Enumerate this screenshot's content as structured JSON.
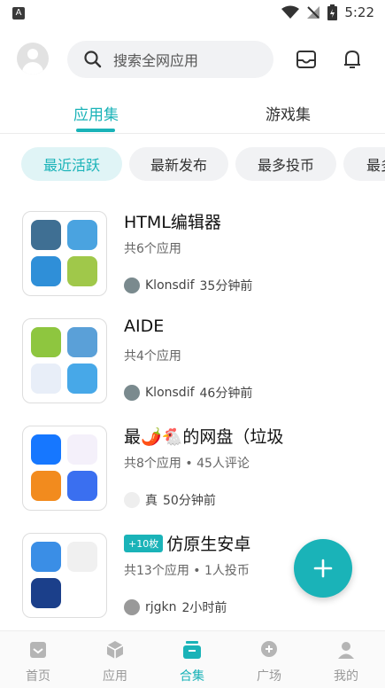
{
  "status": {
    "time": "5:22",
    "left_icon": "A"
  },
  "search": {
    "placeholder": "搜索全网应用"
  },
  "tabs": [
    {
      "label": "应用集",
      "active": true
    },
    {
      "label": "游戏集",
      "active": false
    }
  ],
  "chips": [
    "最近活跃",
    "最新发布",
    "最多投币",
    "最多"
  ],
  "items": [
    {
      "title": "HTML编辑器",
      "meta": "共6个应用",
      "author": "Klonsdif",
      "time": "35分钟前"
    },
    {
      "title": "AIDE",
      "meta": "共4个应用",
      "author": "Klonsdif",
      "time": "46分钟前"
    },
    {
      "title": "最🌶️🐔的网盘（垃圾",
      "meta": "共8个应用 • 45人评论",
      "author": "真",
      "time": "50分钟前"
    },
    {
      "title": "仿原生安卓",
      "badge": "+10枚",
      "meta": "共13个应用 • 1人投币",
      "author": "rjgkn",
      "time": "2小时前"
    }
  ],
  "bottom_nav": [
    "首页",
    "应用",
    "合集",
    "广场",
    "我的"
  ],
  "colors": {
    "accent": "#1ab3b8"
  }
}
